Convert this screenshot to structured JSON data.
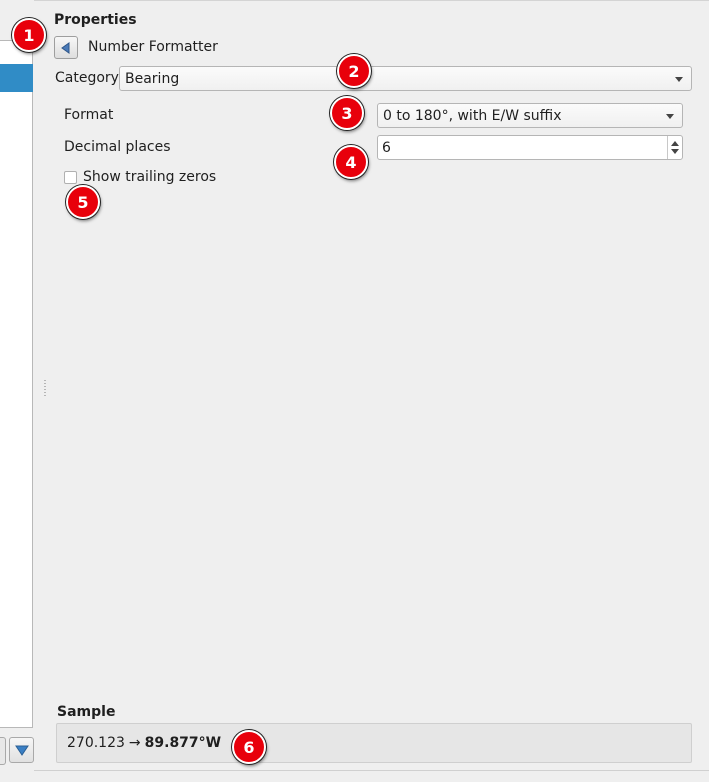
{
  "properties": {
    "title": "Properties",
    "back_label": "Number Formatter"
  },
  "category": {
    "label": "Category",
    "value": "Bearing"
  },
  "format": {
    "label": "Format",
    "value": "0 to 180°, with E/W suffix"
  },
  "decimal_places": {
    "label": "Decimal places",
    "value": "6"
  },
  "trailing_zeros": {
    "label": "Show trailing zeros",
    "checked": false
  },
  "sample": {
    "title": "Sample",
    "input": "270.123",
    "arrow": "→",
    "output": "89.877°W"
  },
  "annotations": [
    "1",
    "2",
    "3",
    "4",
    "5",
    "6"
  ],
  "colors": {
    "selection": "#308cc6",
    "badge": "#e8000b"
  }
}
